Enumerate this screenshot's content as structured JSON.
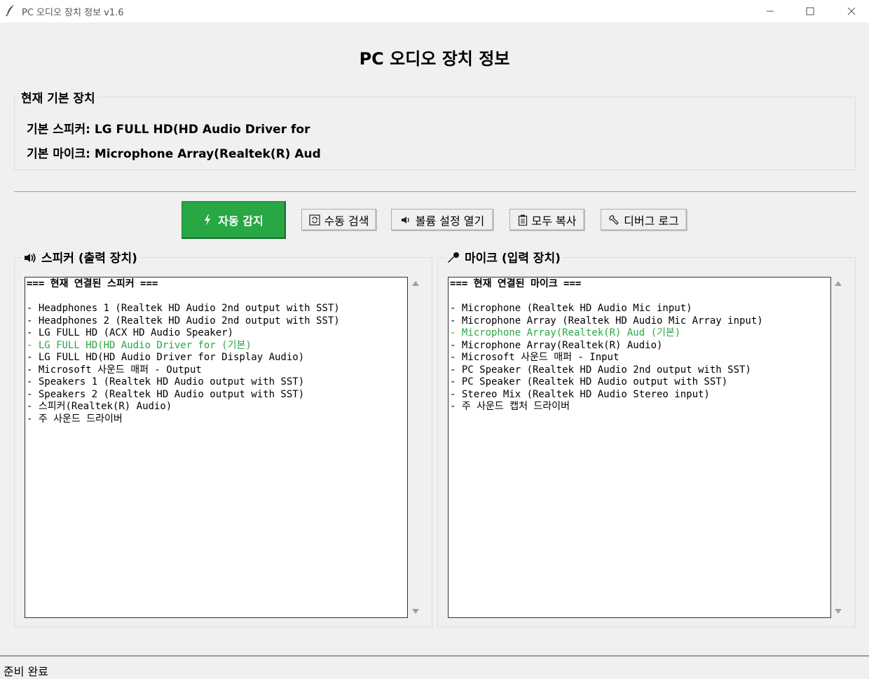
{
  "window": {
    "title": "PC 오디오 장치 정보 v1.6",
    "app_icon": "feather-icon"
  },
  "heading": "PC 오디오 장치 정보",
  "current_defaults": {
    "group_title": "현재 기본 장치",
    "speaker_line": "기본 스피커: LG FULL HD(HD Audio Driver for",
    "mic_line": "기본 마이크: Microphone Array(Realtek(R) Aud"
  },
  "toolbar": {
    "auto_detect": "자동 감지",
    "manual_search": "수동 검색",
    "volume_settings": "볼륨 설정 열기",
    "copy_all": "모두 복사",
    "debug_log": "디버그 로그",
    "auto_color": "#28a745"
  },
  "speakers": {
    "group_title": "스피커 (출력 장치)",
    "header": "=== 현재 연결된 스피커 ===",
    "items": [
      "- Headphones 1 (Realtek HD Audio 2nd output with SST)",
      "- Headphones 2 (Realtek HD Audio 2nd output with SST)",
      "- LG FULL HD (ACX HD Audio Speaker)",
      "- LG FULL HD(HD Audio Driver for (기본)",
      "- LG FULL HD(HD Audio Driver for Display Audio)",
      "- Microsoft 사운드 매퍼 - Output",
      "- Speakers 1 (Realtek HD Audio output with SST)",
      "- Speakers 2 (Realtek HD Audio output with SST)",
      "- 스피커(Realtek(R) Audio)",
      "- 주 사운드 드라이버"
    ],
    "default_index": 3
  },
  "microphones": {
    "group_title": "마이크 (입력 장치)",
    "header": "=== 현재 연결된 마이크 ===",
    "items": [
      "- Microphone (Realtek HD Audio Mic input)",
      "- Microphone Array (Realtek HD Audio Mic Array input)",
      "- Microphone Array(Realtek(R) Aud (기본)",
      "- Microphone Array(Realtek(R) Audio)",
      "- Microsoft 사운드 매퍼 - Input",
      "- PC Speaker (Realtek HD Audio 2nd output with SST)",
      "- PC Speaker (Realtek HD Audio output with SST)",
      "- Stereo Mix (Realtek HD Audio Stereo input)",
      "- 주 사운드 캡처 드라이버"
    ],
    "default_index": 2
  },
  "status": "준비 완료",
  "colors": {
    "highlight": "#28a745",
    "background": "#f0f0f0"
  }
}
